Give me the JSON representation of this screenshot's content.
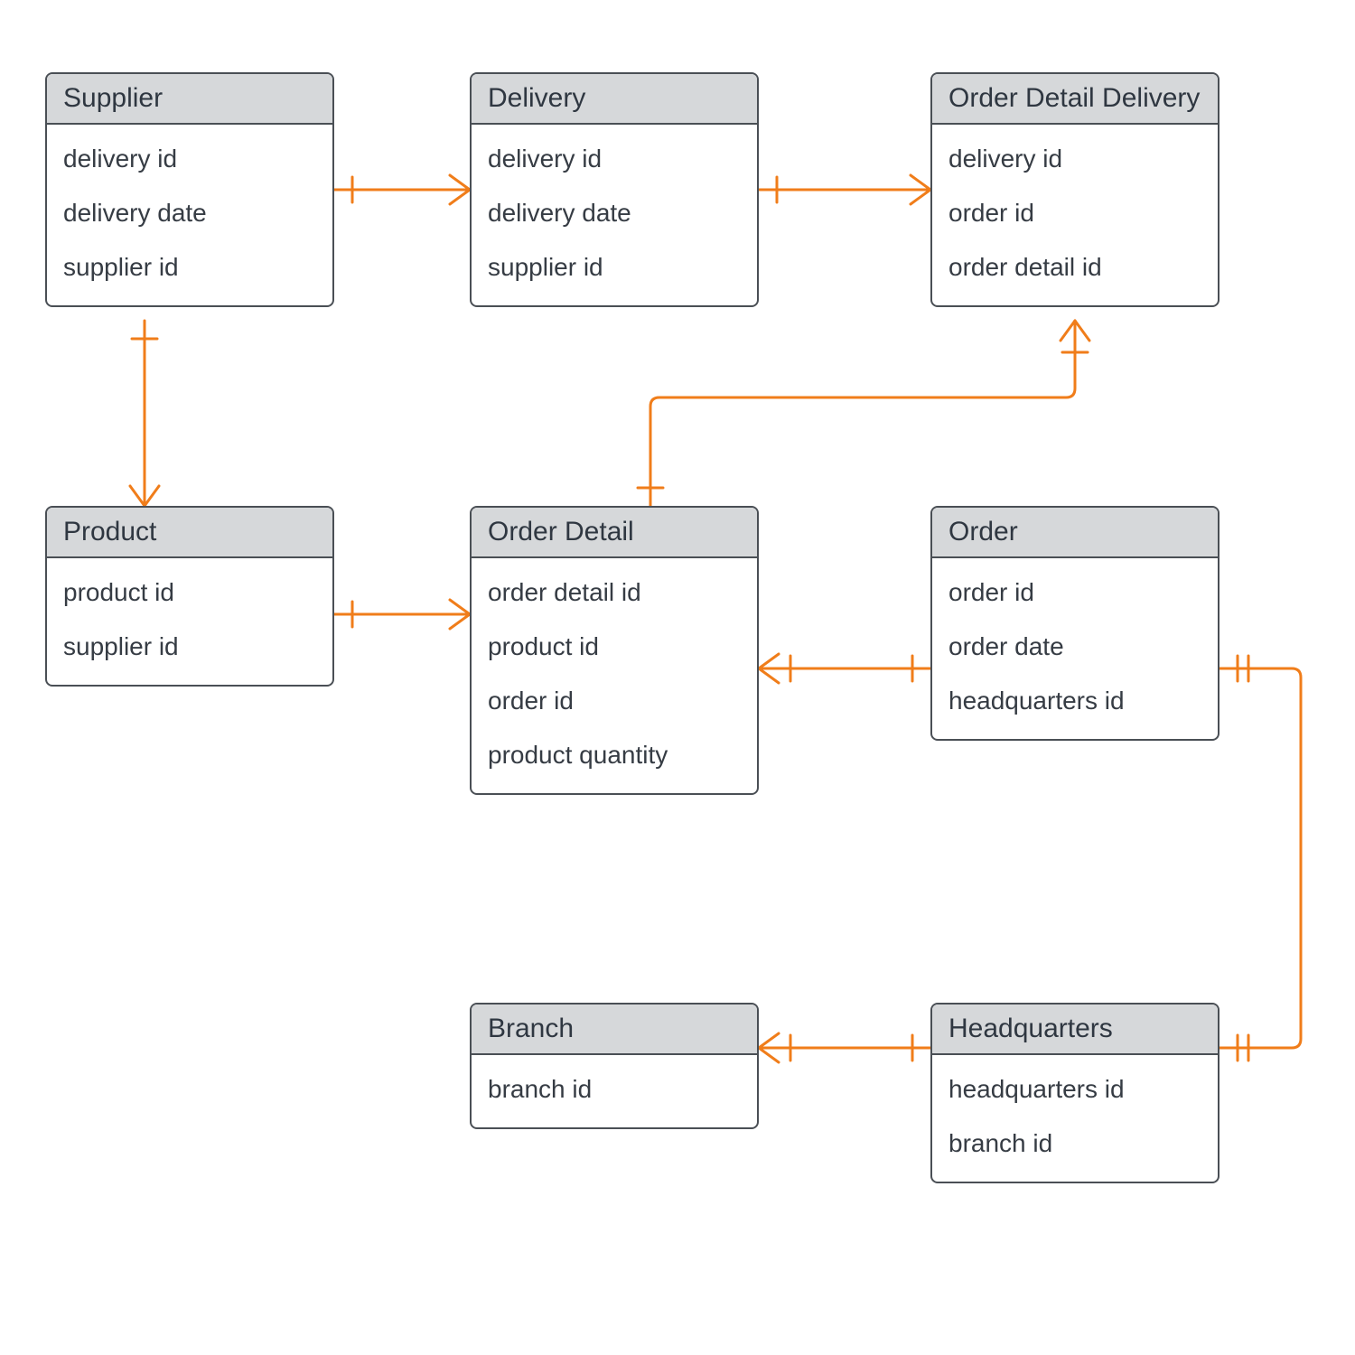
{
  "entities": {
    "supplier": {
      "title": "Supplier",
      "attrs": [
        "delivery id",
        "delivery date",
        "supplier id"
      ]
    },
    "delivery": {
      "title": "Delivery",
      "attrs": [
        "delivery id",
        "delivery date",
        "supplier id"
      ]
    },
    "order_detail_delivery": {
      "title": "Order Detail Delivery",
      "attrs": [
        "delivery id",
        "order id",
        "order detail id"
      ]
    },
    "product": {
      "title": "Product",
      "attrs": [
        "product id",
        "supplier id"
      ]
    },
    "order_detail": {
      "title": "Order Detail",
      "attrs": [
        "order detail id",
        "product id",
        "order id",
        "product quantity"
      ]
    },
    "order": {
      "title": "Order",
      "attrs": [
        "order id",
        "order date",
        "headquarters id"
      ]
    },
    "branch": {
      "title": "Branch",
      "attrs": [
        "branch id"
      ]
    },
    "headquarters": {
      "title": "Headquarters",
      "attrs": [
        "headquarters id",
        "branch id"
      ]
    }
  },
  "relationships": [
    {
      "from": "supplier",
      "to": "delivery",
      "type": "one-to-many"
    },
    {
      "from": "delivery",
      "to": "order_detail_delivery",
      "type": "one-to-many"
    },
    {
      "from": "supplier",
      "to": "product",
      "type": "one-to-many"
    },
    {
      "from": "product",
      "to": "order_detail",
      "type": "one-to-many"
    },
    {
      "from": "order_detail",
      "to": "order_detail_delivery",
      "type": "many-to-one"
    },
    {
      "from": "order",
      "to": "order_detail",
      "type": "one-to-many"
    },
    {
      "from": "headquarters",
      "to": "order",
      "type": "one-to-one"
    },
    {
      "from": "headquarters",
      "to": "branch",
      "type": "one-to-many"
    }
  ],
  "colors": {
    "connector": "#f07d1a",
    "box_border": "#4a4f55",
    "title_bg": "#d6d8da"
  }
}
